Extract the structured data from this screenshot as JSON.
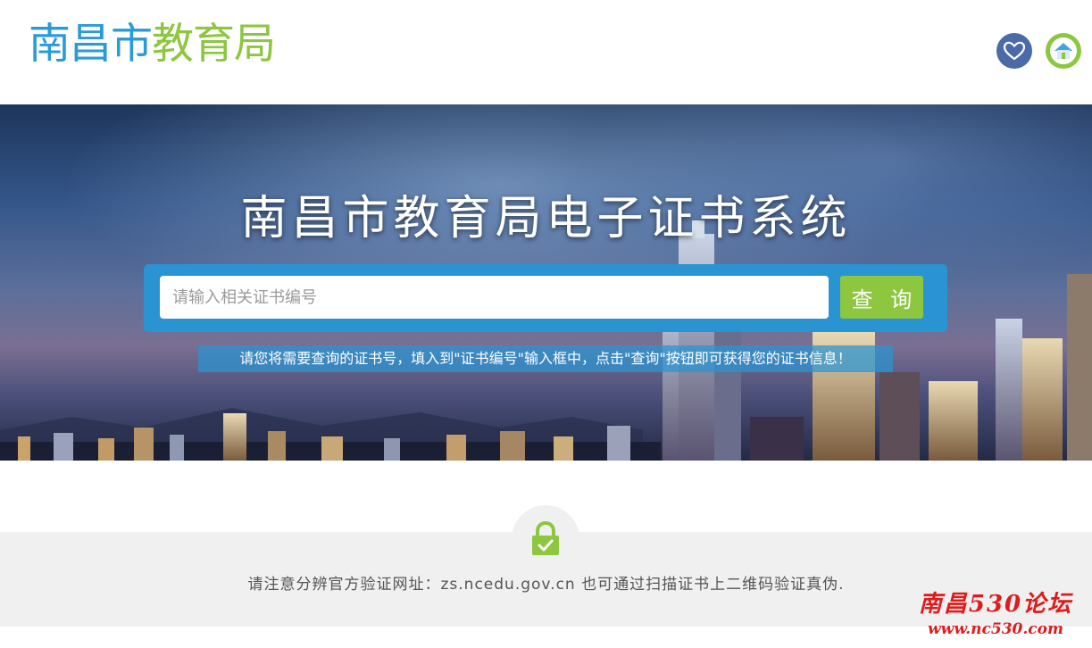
{
  "header": {
    "logo_part1": "南昌市",
    "logo_part2": "教育局",
    "icons": [
      "heart-icon",
      "home-icon"
    ],
    "logo_color_primary": "#2a9bd7",
    "logo_color_secondary": "#8dc63f"
  },
  "banner": {
    "title": "南昌市教育局电子证书系统",
    "search": {
      "placeholder": "请输入相关证书编号",
      "value": "",
      "button_label": "查 询"
    },
    "hint": "请您将需要查询的证书号，填入到\"证书编号\"输入框中，点击\"查询\"按钮即可获得您的证书信息！"
  },
  "footer": {
    "icon": "lock-check-icon",
    "notice": "请注意分辨官方验证网址：zs.ncedu.gov.cn 也可通过扫描证书上二维码验证真伪."
  },
  "watermark": {
    "line1": "南昌530论坛",
    "line2": "www.nc530.com"
  },
  "colors": {
    "accent_blue": "#2a94d3",
    "accent_green": "#8dc63f",
    "footer_bg": "#f0f0f0"
  }
}
